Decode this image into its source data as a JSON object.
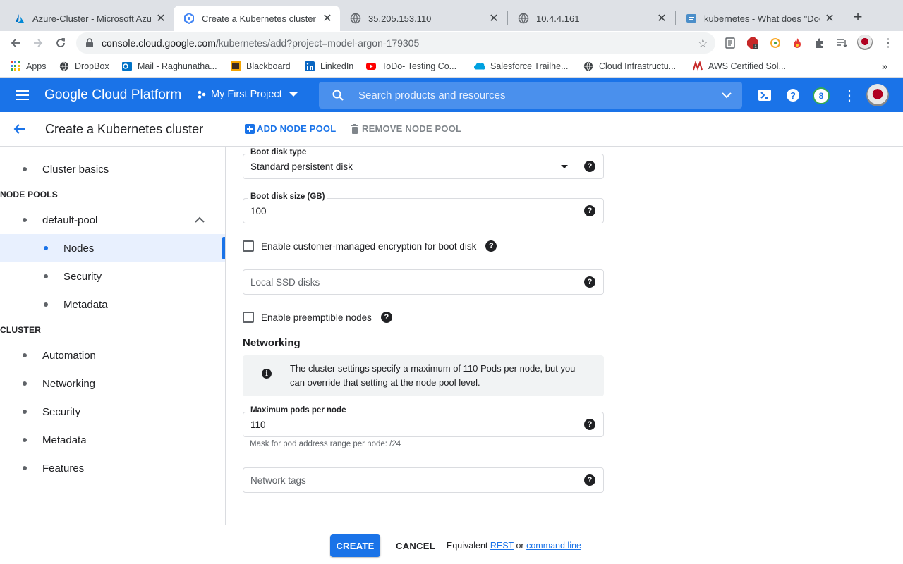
{
  "browser": {
    "tabs": [
      {
        "title": "Azure-Cluster - Microsoft Azu",
        "icon": "azure-icon"
      },
      {
        "title": "Create a Kubernetes cluster – (",
        "icon": "gke-icon"
      },
      {
        "title": "35.205.153.110",
        "icon": "globe-icon"
      },
      {
        "title": "10.4.4.161",
        "icon": "globe-icon"
      },
      {
        "title": "kubernetes - What does \"Does",
        "icon": "stackoverflow-icon"
      }
    ],
    "url_host": "console.cloud.google.com",
    "url_path": "/kubernetes/add?project=model-argon-179305",
    "bookmarks": [
      {
        "label": "Apps",
        "icon": "apps-grid-icon"
      },
      {
        "label": "DropBox",
        "icon": "globe-icon"
      },
      {
        "label": "Mail - Raghunatha...",
        "icon": "outlook-icon"
      },
      {
        "label": "Blackboard",
        "icon": "blackboard-icon"
      },
      {
        "label": "LinkedIn",
        "icon": "linkedin-icon"
      },
      {
        "label": "ToDo- Testing Co...",
        "icon": "youtube-icon"
      },
      {
        "label": "Salesforce Trailhe...",
        "icon": "salesforce-icon"
      },
      {
        "label": "Cloud Infrastructu...",
        "icon": "globe-icon"
      },
      {
        "label": "AWS Certified Sol...",
        "icon": "aws-icon"
      }
    ],
    "more_bookmarks": "»"
  },
  "header": {
    "brand": "Google Cloud Platform",
    "project": "My First Project",
    "search_placeholder": "Search products and resources",
    "notifications_count": "8"
  },
  "page": {
    "title": "Create a Kubernetes cluster",
    "add_node_pool": "ADD NODE POOL",
    "remove_node_pool": "REMOVE NODE POOL"
  },
  "nav": {
    "cluster_basics": "Cluster basics",
    "node_pools_header": "NODE POOLS",
    "default_pool": "default-pool",
    "nodes": "Nodes",
    "pool_security": "Security",
    "pool_metadata": "Metadata",
    "cluster_header": "CLUSTER",
    "automation": "Automation",
    "networking": "Networking",
    "security": "Security",
    "metadata": "Metadata",
    "features": "Features"
  },
  "form": {
    "boot_disk_type_label": "Boot disk type",
    "boot_disk_type_value": "Standard persistent disk",
    "boot_disk_size_label": "Boot disk size (GB)",
    "boot_disk_size_value": "100",
    "cmek_label": "Enable customer-managed encryption for boot disk",
    "local_ssd_placeholder": "Local SSD disks",
    "preemptible_label": "Enable preemptible nodes",
    "networking_heading": "Networking",
    "info_text": "The cluster settings specify a maximum of 110 Pods per node, but you can override that setting at the node pool level.",
    "max_pods_label": "Maximum pods per node",
    "max_pods_value": "110",
    "mask_hint": "Mask for pod address range per node: /24",
    "network_tags_placeholder": "Network tags"
  },
  "footer": {
    "create": "CREATE",
    "cancel": "CANCEL",
    "equivalent": "Equivalent",
    "rest": "REST",
    "or": "or",
    "command_line": "command line"
  },
  "colors": {
    "accent": "#1a73e8",
    "header_bg": "#1a73e8"
  }
}
